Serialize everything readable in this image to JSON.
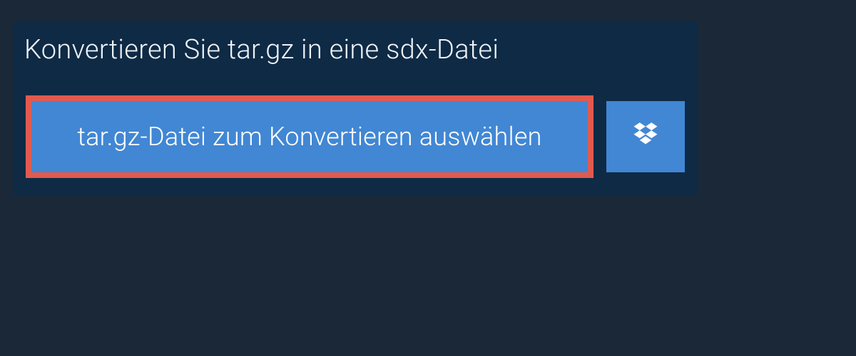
{
  "title": "Konvertieren Sie tar.gz in eine sdx-Datei",
  "select_button_label": "tar.gz-Datei zum Konvertieren auswählen",
  "colors": {
    "page_bg": "#1a2838",
    "panel_bg": "#0f2a45",
    "button_blue": "#4187d4",
    "highlight_border": "#e15a50"
  }
}
